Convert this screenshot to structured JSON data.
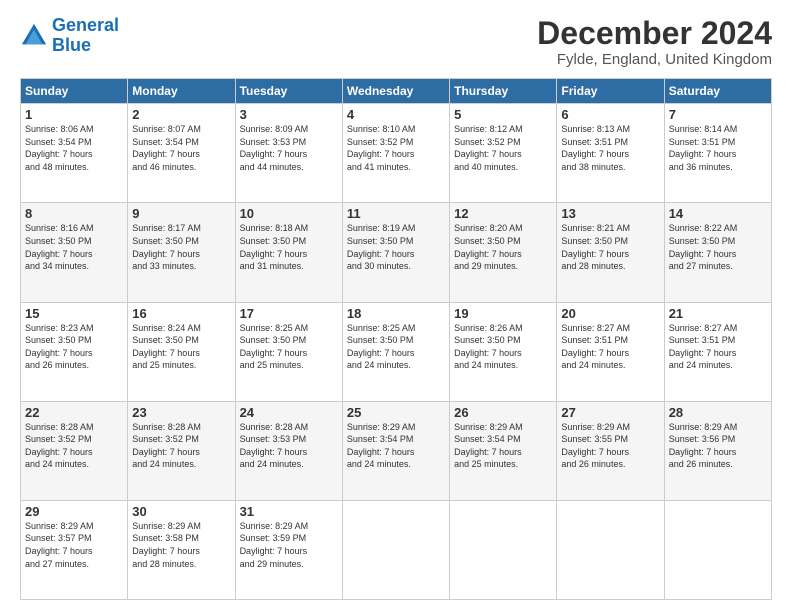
{
  "logo": {
    "line1": "General",
    "line2": "Blue"
  },
  "title": "December 2024",
  "location": "Fylde, England, United Kingdom",
  "days_of_week": [
    "Sunday",
    "Monday",
    "Tuesday",
    "Wednesday",
    "Thursday",
    "Friday",
    "Saturday"
  ],
  "weeks": [
    [
      {
        "day": "1",
        "sunrise": "8:06 AM",
        "sunset": "3:54 PM",
        "daylight": "7 hours and 48 minutes."
      },
      {
        "day": "2",
        "sunrise": "8:07 AM",
        "sunset": "3:54 PM",
        "daylight": "7 hours and 46 minutes."
      },
      {
        "day": "3",
        "sunrise": "8:09 AM",
        "sunset": "3:53 PM",
        "daylight": "7 hours and 44 minutes."
      },
      {
        "day": "4",
        "sunrise": "8:10 AM",
        "sunset": "3:52 PM",
        "daylight": "7 hours and 41 minutes."
      },
      {
        "day": "5",
        "sunrise": "8:12 AM",
        "sunset": "3:52 PM",
        "daylight": "7 hours and 40 minutes."
      },
      {
        "day": "6",
        "sunrise": "8:13 AM",
        "sunset": "3:51 PM",
        "daylight": "7 hours and 38 minutes."
      },
      {
        "day": "7",
        "sunrise": "8:14 AM",
        "sunset": "3:51 PM",
        "daylight": "7 hours and 36 minutes."
      }
    ],
    [
      {
        "day": "8",
        "sunrise": "8:16 AM",
        "sunset": "3:50 PM",
        "daylight": "7 hours and 34 minutes."
      },
      {
        "day": "9",
        "sunrise": "8:17 AM",
        "sunset": "3:50 PM",
        "daylight": "7 hours and 33 minutes."
      },
      {
        "day": "10",
        "sunrise": "8:18 AM",
        "sunset": "3:50 PM",
        "daylight": "7 hours and 31 minutes."
      },
      {
        "day": "11",
        "sunrise": "8:19 AM",
        "sunset": "3:50 PM",
        "daylight": "7 hours and 30 minutes."
      },
      {
        "day": "12",
        "sunrise": "8:20 AM",
        "sunset": "3:50 PM",
        "daylight": "7 hours and 29 minutes."
      },
      {
        "day": "13",
        "sunrise": "8:21 AM",
        "sunset": "3:50 PM",
        "daylight": "7 hours and 28 minutes."
      },
      {
        "day": "14",
        "sunrise": "8:22 AM",
        "sunset": "3:50 PM",
        "daylight": "7 hours and 27 minutes."
      }
    ],
    [
      {
        "day": "15",
        "sunrise": "8:23 AM",
        "sunset": "3:50 PM",
        "daylight": "7 hours and 26 minutes."
      },
      {
        "day": "16",
        "sunrise": "8:24 AM",
        "sunset": "3:50 PM",
        "daylight": "7 hours and 25 minutes."
      },
      {
        "day": "17",
        "sunrise": "8:25 AM",
        "sunset": "3:50 PM",
        "daylight": "7 hours and 25 minutes."
      },
      {
        "day": "18",
        "sunrise": "8:25 AM",
        "sunset": "3:50 PM",
        "daylight": "7 hours and 24 minutes."
      },
      {
        "day": "19",
        "sunrise": "8:26 AM",
        "sunset": "3:50 PM",
        "daylight": "7 hours and 24 minutes."
      },
      {
        "day": "20",
        "sunrise": "8:27 AM",
        "sunset": "3:51 PM",
        "daylight": "7 hours and 24 minutes."
      },
      {
        "day": "21",
        "sunrise": "8:27 AM",
        "sunset": "3:51 PM",
        "daylight": "7 hours and 24 minutes."
      }
    ],
    [
      {
        "day": "22",
        "sunrise": "8:28 AM",
        "sunset": "3:52 PM",
        "daylight": "7 hours and 24 minutes."
      },
      {
        "day": "23",
        "sunrise": "8:28 AM",
        "sunset": "3:52 PM",
        "daylight": "7 hours and 24 minutes."
      },
      {
        "day": "24",
        "sunrise": "8:28 AM",
        "sunset": "3:53 PM",
        "daylight": "7 hours and 24 minutes."
      },
      {
        "day": "25",
        "sunrise": "8:29 AM",
        "sunset": "3:54 PM",
        "daylight": "7 hours and 24 minutes."
      },
      {
        "day": "26",
        "sunrise": "8:29 AM",
        "sunset": "3:54 PM",
        "daylight": "7 hours and 25 minutes."
      },
      {
        "day": "27",
        "sunrise": "8:29 AM",
        "sunset": "3:55 PM",
        "daylight": "7 hours and 26 minutes."
      },
      {
        "day": "28",
        "sunrise": "8:29 AM",
        "sunset": "3:56 PM",
        "daylight": "7 hours and 26 minutes."
      }
    ],
    [
      {
        "day": "29",
        "sunrise": "8:29 AM",
        "sunset": "3:57 PM",
        "daylight": "7 hours and 27 minutes."
      },
      {
        "day": "30",
        "sunrise": "8:29 AM",
        "sunset": "3:58 PM",
        "daylight": "7 hours and 28 minutes."
      },
      {
        "day": "31",
        "sunrise": "8:29 AM",
        "sunset": "3:59 PM",
        "daylight": "7 hours and 29 minutes."
      },
      null,
      null,
      null,
      null
    ]
  ]
}
